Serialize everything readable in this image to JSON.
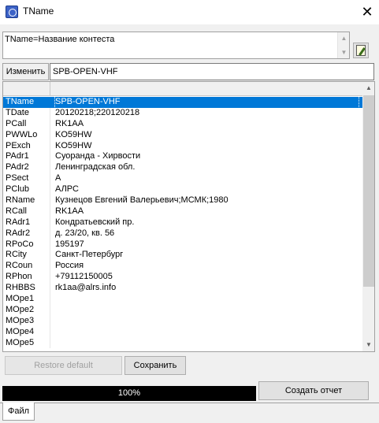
{
  "window": {
    "title": "TName"
  },
  "memo": {
    "text": "TName=Название контеста"
  },
  "editor": {
    "label": "Изменить",
    "value": "SPB-OPEN-VHF"
  },
  "grid": {
    "rows": [
      {
        "key": "TName",
        "value": "SPB-OPEN-VHF"
      },
      {
        "key": "TDate",
        "value": "20120218;220120218"
      },
      {
        "key": "PCall",
        "value": "RK1AA"
      },
      {
        "key": "PWWLo",
        "value": "KO59HW"
      },
      {
        "key": "PExch",
        "value": "KO59HW"
      },
      {
        "key": "PAdr1",
        "value": "Суоранда - Хирвости"
      },
      {
        "key": "PAdr2",
        "value": "Ленинградская обл."
      },
      {
        "key": "PSect",
        "value": "A"
      },
      {
        "key": "PClub",
        "value": "АЛРС"
      },
      {
        "key": "RName",
        "value": "Кузнецов Евгений Валерьевич;МСМК;1980"
      },
      {
        "key": "RCall",
        "value": "RK1AA"
      },
      {
        "key": "RAdr1",
        "value": "Кондратьевский пр."
      },
      {
        "key": "RAdr2",
        "value": "д. 23/20, кв. 56"
      },
      {
        "key": "RPoCo",
        "value": "195197"
      },
      {
        "key": "RCity",
        "value": "Санкт-Петербург"
      },
      {
        "key": "RCoun",
        "value": "Россия"
      },
      {
        "key": "RPhon",
        "value": "+79112150005"
      },
      {
        "key": "RHBBS",
        "value": "rk1aa@alrs.info"
      },
      {
        "key": "MOpe1",
        "value": ""
      },
      {
        "key": "MOpe2",
        "value": ""
      },
      {
        "key": "MOpe3",
        "value": ""
      },
      {
        "key": "MOpe4",
        "value": ""
      },
      {
        "key": "MOpe5",
        "value": ""
      }
    ],
    "selected_index": 0
  },
  "buttons": {
    "restore_default": "Restore default",
    "save": "Сохранить",
    "create_report": "Создать отчет"
  },
  "progress": {
    "label": "100%",
    "value": 1.0
  },
  "tabs": {
    "file": "Файл"
  },
  "icons": {
    "app": "app-icon",
    "close": "close-icon",
    "memo_edit": "edit-note-icon",
    "scroll_up": "chevron-up-icon",
    "scroll_down": "chevron-down-icon"
  },
  "colors": {
    "selection": "#0078d7",
    "progress_fill": "#000000"
  }
}
